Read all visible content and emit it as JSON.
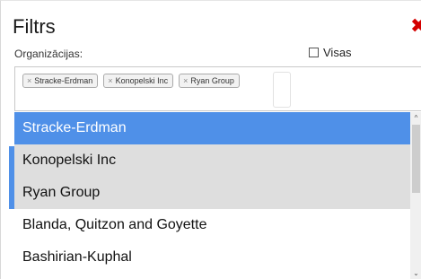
{
  "dialog": {
    "title": "Filtrs",
    "close_icon": "close-icon",
    "close_color": "#d40000"
  },
  "organizations": {
    "label": "Organizācijas:",
    "select_all_label": "Visas",
    "select_all_checked": false,
    "selected_tags": [
      {
        "label": "Stracke-Erdman",
        "remove_glyph": "×"
      },
      {
        "label": "Konopelski Inc",
        "remove_glyph": "×"
      },
      {
        "label": "Ryan Group",
        "remove_glyph": "×"
      }
    ],
    "options": [
      {
        "label": "Stracke-Erdman",
        "state": "highlighted"
      },
      {
        "label": "Konopelski Inc",
        "state": "selected"
      },
      {
        "label": "Ryan Group",
        "state": "selected"
      },
      {
        "label": "Blanda, Quitzon and Goyette",
        "state": "normal"
      },
      {
        "label": "Bashirian-Kuphal",
        "state": "normal"
      }
    ]
  },
  "colors": {
    "highlight": "#4f90e8",
    "selected_bg": "#dedede",
    "close": "#d40000"
  },
  "scrollbar": {
    "up_glyph": "^",
    "down_glyph": "⌄"
  }
}
